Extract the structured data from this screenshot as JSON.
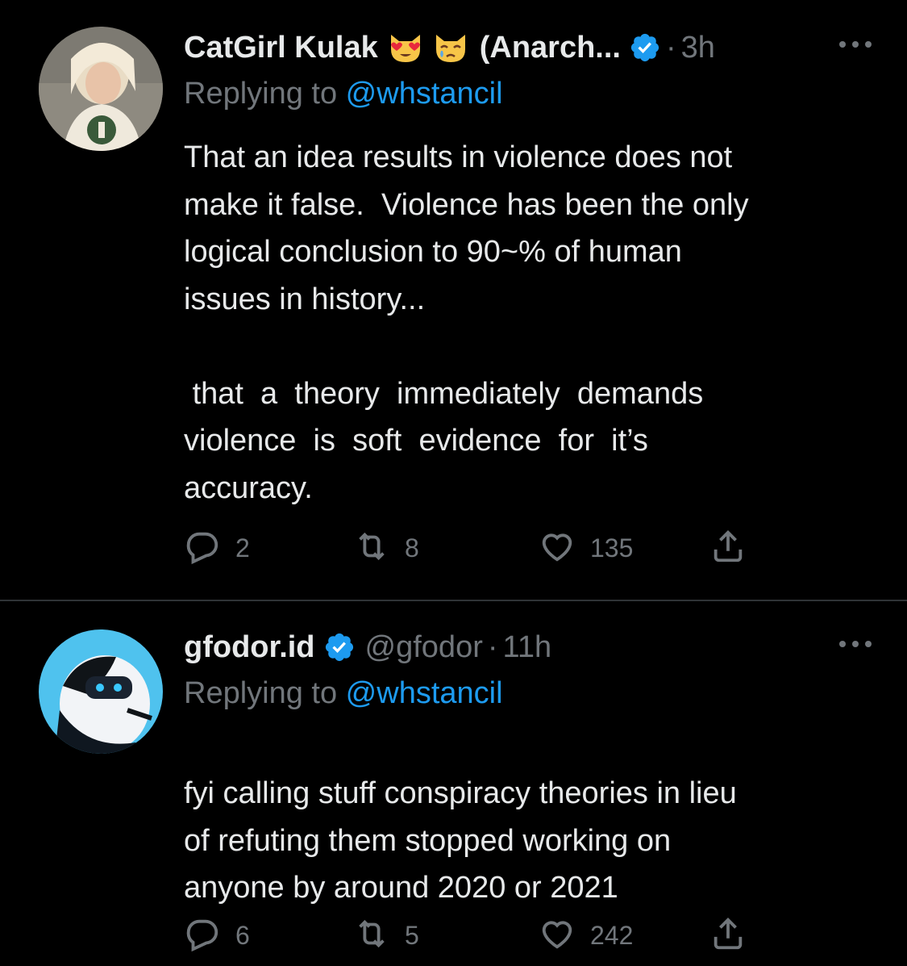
{
  "tweets": [
    {
      "display_name": "CatGirl Kulak",
      "emojis": [
        "heart-eyes-cat-emoji",
        "crying-cat-emoji"
      ],
      "name_suffix": "(Anarch...",
      "verified": true,
      "handle": "",
      "timestamp": "3h",
      "replying_prefix": "Replying to ",
      "replying_to": "@whstancil",
      "text": "That an idea results in violence does not\nmake it false.  Violence has been the only\nlogical conclusion to 90~% of human\nissues in history...\n\n that  a  theory  immediately  demands\nviolence  is  soft  evidence  for  it’s\naccuracy.",
      "replies": "2",
      "retweets": "8",
      "likes": "135"
    },
    {
      "display_name": "gfodor.id",
      "verified": true,
      "handle": "@gfodor",
      "timestamp": "11h",
      "replying_prefix": "Replying to ",
      "replying_to": "@whstancil",
      "text": "fyi calling stuff conspiracy theories in lieu\nof refuting them stopped working on\nanyone by around 2020 or 2021",
      "replies": "6",
      "retweets": "5",
      "likes": "242"
    }
  ],
  "colors": {
    "background": "#000000",
    "primary_text": "#e7e9ea",
    "secondary_text": "#71767b",
    "accent": "#1d9bf0",
    "divider": "#2f3336"
  },
  "icons": {
    "reply": "reply-icon",
    "retweet": "retweet-icon",
    "like": "heart-icon",
    "share": "share-icon",
    "more": "more-icon",
    "verified": "verified-badge-icon"
  }
}
